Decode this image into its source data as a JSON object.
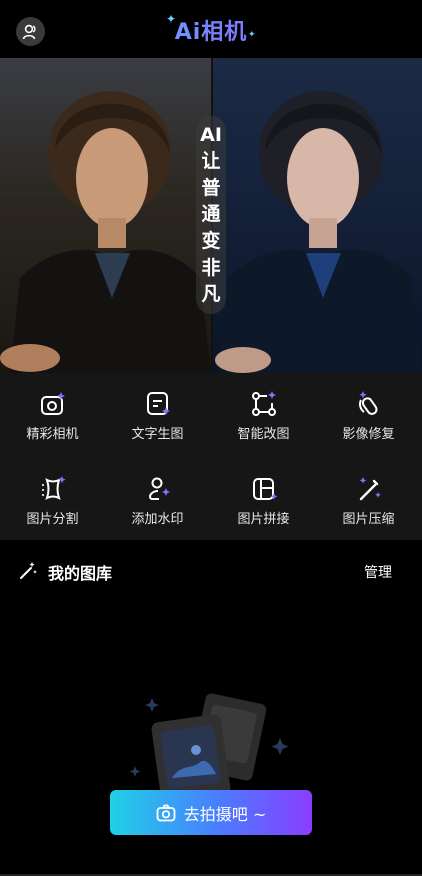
{
  "header": {
    "title": "Ai相机",
    "avatar_icon": "user-icon"
  },
  "hero": {
    "slogan": [
      "AI",
      "让",
      "普",
      "通",
      "变",
      "非",
      "凡"
    ]
  },
  "tools": [
    {
      "label": "精彩相机",
      "icon": "camera-sparkle-icon"
    },
    {
      "label": "文字生图",
      "icon": "text-to-image-icon"
    },
    {
      "label": "智能改图",
      "icon": "vector-edit-icon"
    },
    {
      "label": "影像修复",
      "icon": "restore-pen-icon"
    },
    {
      "label": "图片分割",
      "icon": "segment-icon"
    },
    {
      "label": "添加水印",
      "icon": "watermark-icon"
    },
    {
      "label": "图片拼接",
      "icon": "stitch-icon"
    },
    {
      "label": "图片压缩",
      "icon": "compress-wand-icon"
    }
  ],
  "gallery": {
    "title": "我的图库",
    "manage": "管理"
  },
  "shoot_button": {
    "label": "去拍摄吧 ~"
  },
  "colors": {
    "accent_start": "#1fd1e6",
    "accent_mid": "#4b7bff",
    "accent_end": "#8a3dff",
    "tools_bg": "#161616"
  }
}
